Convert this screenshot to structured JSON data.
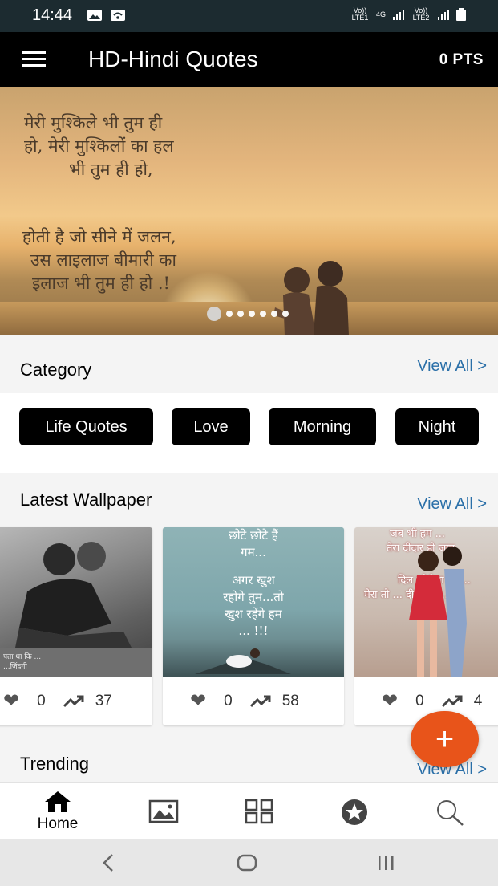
{
  "status_bar": {
    "time": "14:44",
    "sim1": "Vo)) LTE1",
    "network": "4G",
    "sim2": "Vo)) LTE2",
    "icons": [
      "gallery-icon",
      "wifi-icon",
      "signal-icon",
      "battery-icon"
    ]
  },
  "app_bar": {
    "title": "HD-Hindi Quotes",
    "points": "0 PTS",
    "menu_icon": "hamburger-menu-icon"
  },
  "banner": {
    "quote_lines_1": [
      "मेरी मुश्किले भी तुम ही",
      "हो, मेरी मुश्किलों का हल",
      "भी तुम ही हो,"
    ],
    "quote_lines_2": [
      "होती है जो सीने में जलन,",
      "उस लाइलाज बीमारी का",
      "इलाज भी तुम ही हो .!"
    ],
    "slide_count": 7,
    "active_slide": 0
  },
  "category": {
    "heading": "Category",
    "view_all": "View All >",
    "chips": [
      "Life Quotes",
      "Love",
      "Morning",
      "Night"
    ]
  },
  "latest_wallpaper": {
    "heading": "Latest Wallpaper",
    "view_all": "View All >",
    "cards": [
      {
        "likes": "0",
        "trend": "37",
        "caption_lines": [
          "पता था कि ...",
          "...जिंदगी"
        ]
      },
      {
        "likes": "0",
        "trend": "58",
        "caption_lines": [
          "छोटे छोटे हैं",
          "गम...",
          "अगर खुश",
          "रहोगे तुम...तो",
          "खुश रहेंगे हम",
          "... !!!"
        ]
      },
      {
        "likes": "0",
        "trend": "4",
        "caption_lines": [
          "जब भी हम ...",
          "तेरा दीदार हो जात",
          "दिल कोई ना भी ...",
          "मेरा तो ... दीदार हो ..."
        ]
      }
    ]
  },
  "trending": {
    "heading": "Trending",
    "view_all": "View All >"
  },
  "fab": {
    "label": "+"
  },
  "bottom_nav": {
    "items": [
      {
        "label": "Home",
        "icon": "home-icon"
      },
      {
        "label": "",
        "icon": "image-icon"
      },
      {
        "label": "",
        "icon": "grid-icon"
      },
      {
        "label": "",
        "icon": "star-badge-icon"
      },
      {
        "label": "",
        "icon": "search-icon"
      }
    ]
  },
  "system_nav": {
    "icons": [
      "back-icon",
      "home-circle-icon",
      "recents-icon"
    ]
  },
  "colors": {
    "accent": "#e8541a",
    "link": "#2a6fa8",
    "appbar": "#000000",
    "statusbar": "#1c2b30"
  }
}
